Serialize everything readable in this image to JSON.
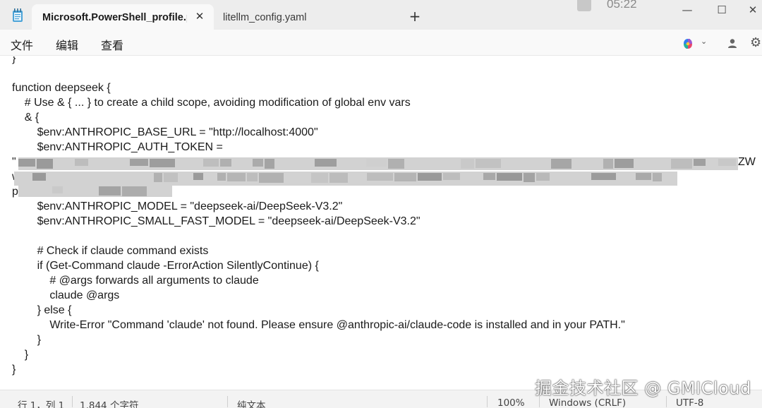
{
  "tabs": [
    {
      "label": "Microsoft.PowerShell_profile.ps",
      "active": true
    },
    {
      "label": "litellm_config.yaml",
      "active": false
    }
  ],
  "titlebar": {
    "clock": "05:22",
    "new_tab": "+",
    "minimize": "—",
    "maximize": "☐",
    "close": "✕"
  },
  "menu": {
    "file": "文件",
    "edit": "编辑",
    "view": "查看"
  },
  "editor": {
    "lines": [
      "}",
      "",
      "function deepseek {",
      "    # Use & { ... } to create a child scope, avoiding modification of global env vars",
      "    & {",
      "        $env:ANTHROPIC_BASE_URL = \"http://localhost:4000\"",
      "        $env:ANTHROPIC_AUTH_TOKEN =",
      "\"",
      "w",
      "p",
      "        $env:ANTHROPIC_MODEL = \"deepseek-ai/DeepSeek-V3.2\"",
      "        $env:ANTHROPIC_SMALL_FAST_MODEL = \"deepseek-ai/DeepSeek-V3.2\"",
      "",
      "        # Check if claude command exists",
      "        if (Get-Command claude -ErrorAction SilentlyContinue) {",
      "            # @args forwards all arguments to claude",
      "            claude @args",
      "        } else {",
      "            Write-Error \"Command 'claude' not found. Please ensure @anthropic-ai/claude-code is installed and in your PATH.\"",
      "        }",
      "    }",
      "}"
    ],
    "token_tail": "ZW"
  },
  "status": {
    "position": "行 1，列 1",
    "chars": "1,844 个字符",
    "format": "纯文本",
    "zoom": "100%",
    "line_ending": "Windows (CRLF)",
    "encoding": "UTF-8"
  },
  "watermark": "掘金技术社区 @ GMICloud",
  "icons": {
    "app": "notepad-icon",
    "tab_close": "close-icon",
    "copilot": "copilot-icon",
    "account": "profile-icon",
    "settings": "gear-icon"
  },
  "colors": {
    "titlebar": "#ededed",
    "tab_active": "#f9f9f9",
    "editor_bg": "#ffffff",
    "statusbar": "#f3f3f3"
  }
}
